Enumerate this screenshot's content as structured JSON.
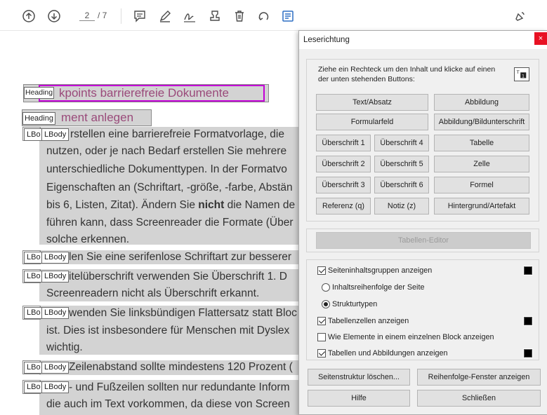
{
  "toolbar": {
    "page_current": "2",
    "page_total": "/ 7",
    "icons": [
      "arrow-up-icon",
      "arrow-down-icon",
      "comment-icon",
      "pen-icon",
      "sign-icon",
      "stamp-icon",
      "trash-icon",
      "undo-icon",
      "reading-order-icon",
      "share-icon"
    ]
  },
  "document": {
    "heading1": "kpoints barrierefreie Dokumente",
    "heading2": "ment anlegen",
    "tag_heading": "Heading",
    "tag_lbody": "LBody",
    "tag_lbo": "LBo",
    "p1": [
      "rstellen eine barrierefreie Formatvorlage, die",
      "nutzen, oder je nach Bedarf erstellen Sie mehrere",
      "unterschiedliche Dokumenttypen. In der Formatvo",
      "Eigenschaften an (Schriftart, -größe, -farbe, Abstän",
      "bis 6, Listen, Zitat). Ändern Sie ",
      "führen kann, dass Screenreader die Formate (Über",
      "solche erkennen."
    ],
    "p1_bold": "nicht",
    "p1_after_bold": " die Namen de",
    "p2": [
      "len Sie eine serifenlose Schriftart zur besserer"
    ],
    "p3": [
      "itelüberschrift verwenden Sie Überschrift 1. D",
      "Screenreadern nicht als Überschrift erkannt."
    ],
    "p4": [
      "wenden Sie linksbündigen Flattersatz statt Bloc",
      "ist. Dies ist insbesondere für Menschen mit Dyslex",
      "wichtig."
    ],
    "p5": [
      "Zeilenabstand sollte mindestens 120 Prozent ("
    ],
    "p6": [
      "- und Fußzeilen sollten nur redundante Inform",
      "die auch im Text vorkommen, da diese von Screen"
    ]
  },
  "dialog": {
    "title": "Leserichtung",
    "close": "×",
    "instruction": "Ziehe ein Rechteck um den Inhalt und klicke auf einen der unten stehenden Buttons:",
    "buttons": {
      "text_absatz": "Text/Absatz",
      "abbildung": "Abbildung",
      "formularfeld": "Formularfeld",
      "abbildung_bildunterschrift": "Abbildung/Bildunterschrift",
      "ueberschrift1": "Überschrift 1",
      "ueberschrift4": "Überschrift 4",
      "tabelle": "Tabelle",
      "ueberschrift2": "Überschrift 2",
      "ueberschrift5": "Überschrift 5",
      "zelle": "Zelle",
      "ueberschrift3": "Überschrift 3",
      "ueberschrift6": "Überschrift 6",
      "formel": "Formel",
      "referenz": "Referenz (q)",
      "notiz": "Notiz (z)",
      "hintergrund": "Hintergrund/Artefakt",
      "tabellen_editor": "Tabellen-Editor",
      "seitenstruktur_loeschen": "Seitenstruktur löschen...",
      "reihenfolge_fenster": "Reihenfolge-Fenster anzeigen",
      "hilfe": "Hilfe",
      "schliessen": "Schließen"
    },
    "options": {
      "seiteninhaltsgruppen": "Seiteninhaltsgruppen anzeigen",
      "inhaltsreihenfolge": "Inhaltsreihenfolge der Seite",
      "strukturtypen": "Strukturtypen",
      "tabellenzellen": "Tabellenzellen anzeigen",
      "wie_elemente": "Wie Elemente in einem einzelnen Block anzeigen",
      "tabellen_abbildungen": "Tabellen und Abbildungen anzeigen"
    },
    "state": {
      "seiteninhaltsgruppen_checked": true,
      "selected_radio": "strukturtypen",
      "tabellenzellen_checked": true,
      "wie_elemente_checked": false,
      "tabellen_abbildungen_checked": true
    }
  },
  "colors": {
    "heading_text": "#9a4a7a",
    "highlight_magenta": "#c300d6",
    "toolbar_icon": "#4b4b4b",
    "reading_order_icon": "#2d6fc4",
    "close_button": "#e81123",
    "tag_fill": "#d3d3d3"
  }
}
